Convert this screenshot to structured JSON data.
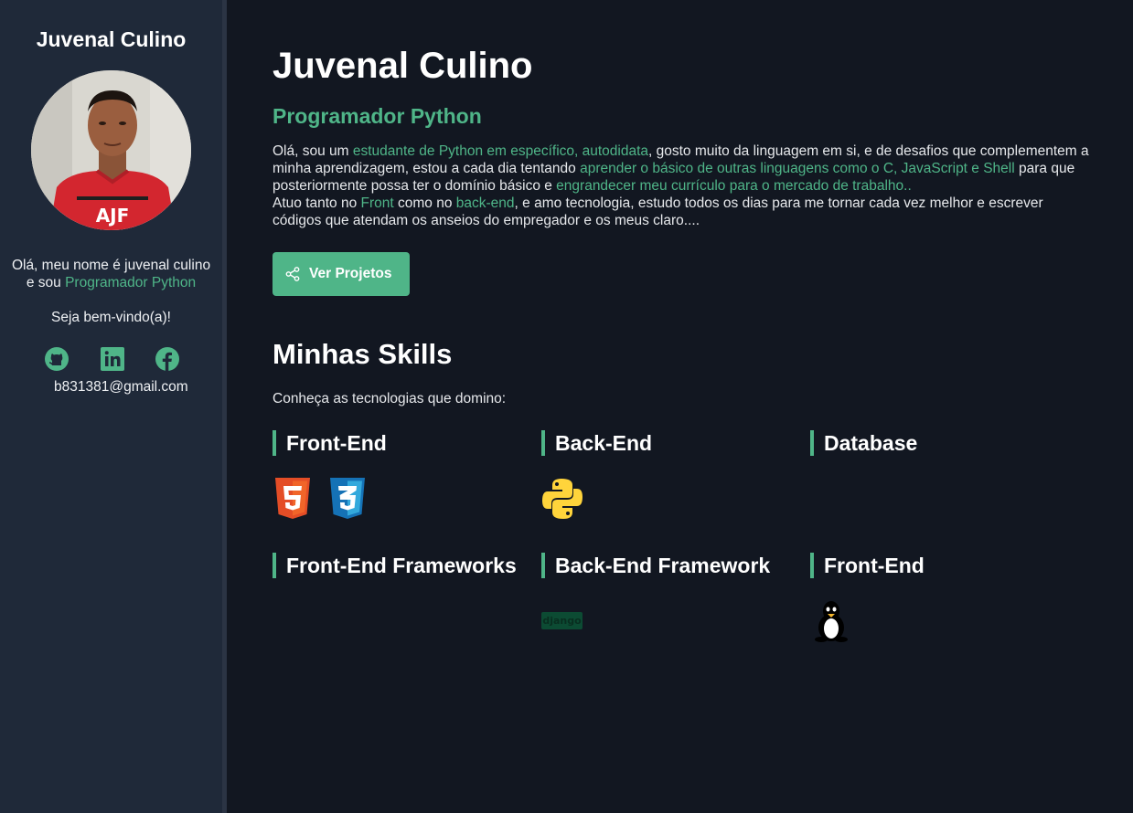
{
  "sidebar": {
    "name": "Juvenal Culino",
    "intro_line1": "Olá, meu nome é juvenal culino",
    "intro_line2_prefix": "e sou ",
    "intro_highlight": "Programador Python",
    "welcome": "Seja bem-vindo(a)!",
    "social_icons": [
      "github-icon",
      "linkedin-icon",
      "facebook-icon"
    ],
    "email": "b831381@gmail.com"
  },
  "main": {
    "title": "Juvenal Culino",
    "subtitle": "Programador Python",
    "bio": {
      "p1": "Olá, sou um ",
      "h1": "estudante de Python em específico, autodidata",
      "p2": ", gosto muito da linguagem em si, e de desafios que complementem a minha aprendizagem, estou a cada dia tentando ",
      "h2": "aprender o básico de outras linguagens como o C, JavaScript e Shell",
      "p3": " para que posteriormente possa ter o domínio básico e ",
      "h3": "engrandecer meu currículo para o mercado de trabalho..",
      "p4": "Atuo tanto no ",
      "h4": "Front",
      "p5": " como no ",
      "h5": "back-end",
      "p6": ", e amo tecnologia, estudo todos os dias para me tornar cada vez melhor e escrever códigos que atendam os anseios do empregador e os meus claro...."
    },
    "button_label": "Ver Projetos",
    "skills_title": "Minhas Skills",
    "skills_desc": "Conheça as tecnologias que domino:",
    "categories": [
      {
        "name": "Front-End",
        "icons": [
          "html5-icon",
          "css3-icon"
        ]
      },
      {
        "name": "Back-End",
        "icons": [
          "python-icon"
        ]
      },
      {
        "name": "Database",
        "icons": []
      },
      {
        "name": "Front-End Frameworks",
        "icons": []
      },
      {
        "name": "Back-End Framework",
        "icons": [
          "django-icon"
        ]
      },
      {
        "name": "Front-End",
        "icons": [
          "linux-icon"
        ]
      }
    ],
    "django_text": "django"
  },
  "colors": {
    "accent": "#4fb588",
    "background": "#121721",
    "sidebar": "#1f2939"
  }
}
